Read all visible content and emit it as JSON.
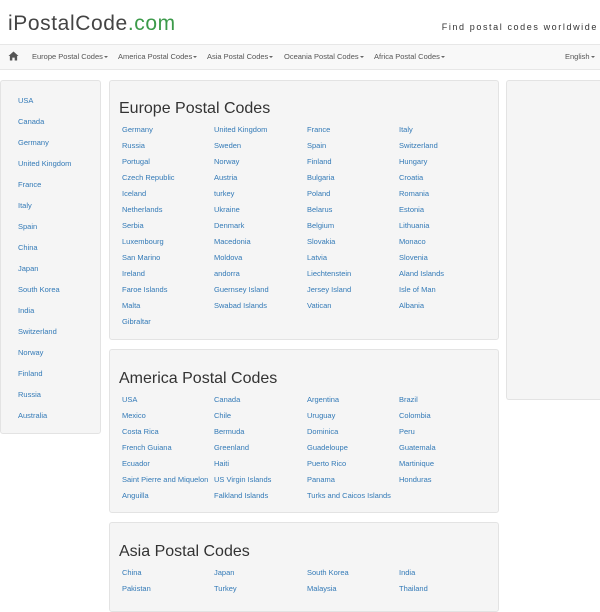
{
  "header": {
    "logo_main": "iPostalCode",
    "logo_tld": ".com",
    "tagline": "Find postal codes worldwide"
  },
  "nav": {
    "items": [
      "Europe Postal Codes",
      "America Postal Codes",
      "Asia Postal Codes",
      "Oceania Postal Codes",
      "Africa Postal Codes"
    ],
    "language": "English"
  },
  "sidebar": {
    "items": [
      "USA",
      "Canada",
      "Germany",
      "United Kingdom",
      "France",
      "Italy",
      "Spain",
      "China",
      "Japan",
      "South Korea",
      "India",
      "Switzerland",
      "Norway",
      "Finland",
      "Russia",
      "Australia"
    ]
  },
  "sections": [
    {
      "title": "Europe Postal Codes",
      "links": [
        "Germany",
        "United Kingdom",
        "France",
        "Italy",
        "Russia",
        "Sweden",
        "Spain",
        "Switzerland",
        "Portugal",
        "Norway",
        "Finland",
        "Hungary",
        "Czech Republic",
        "Austria",
        "Bulgaria",
        "Croatia",
        "Iceland",
        "turkey",
        "Poland",
        "Romania",
        "Netherlands",
        "Ukraine",
        "Belarus",
        "Estonia",
        "Serbia",
        "Denmark",
        "Belgium",
        "Lithuania",
        "Luxembourg",
        "Macedonia",
        "Slovakia",
        "Monaco",
        "San Marino",
        "Moldova",
        "Latvia",
        "Slovenia",
        "Ireland",
        "andorra",
        "Liechtenstein",
        "Aland Islands",
        "Faroe Islands",
        "Guernsey Island",
        "Jersey Island",
        "Isle of Man",
        "Malta",
        "Swabad Islands",
        "Vatican",
        "Albania",
        "Gibraltar"
      ]
    },
    {
      "title": "America Postal Codes",
      "links": [
        "USA",
        "Canada",
        "Argentina",
        "Brazil",
        "Mexico",
        "Chile",
        "Uruguay",
        "Colombia",
        "Costa Rica",
        "Bermuda",
        "Dominica",
        "Peru",
        "French Guiana",
        "Greenland",
        "Guadeloupe",
        "Guatemala",
        "Ecuador",
        "Haiti",
        "Puerto Rico",
        "Martinique",
        "Saint Pierre and Miquelon",
        "US Virgin Islands",
        "Panama",
        "Honduras",
        "Anguilla",
        "Falkland Islands",
        "Turks and Caicos Islands"
      ]
    },
    {
      "title": "Asia Postal Codes",
      "links": [
        "China",
        "Japan",
        "South Korea",
        "India",
        "Pakistan",
        "Turkey",
        "Malaysia",
        "Thailand"
      ]
    }
  ]
}
